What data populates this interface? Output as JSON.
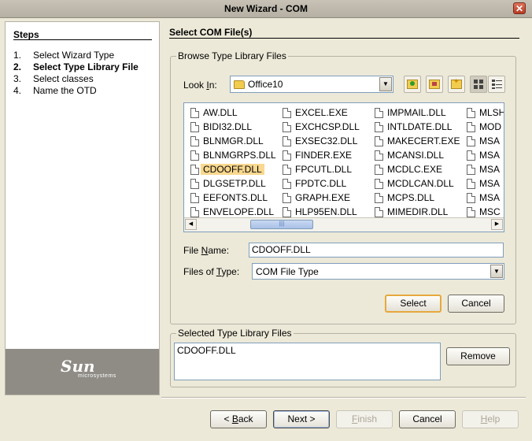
{
  "window": {
    "title": "New Wizard - COM",
    "close_glyph": "✕"
  },
  "steps": {
    "title": "Steps",
    "items": [
      {
        "num": "1.",
        "label": "Select Wizard Type"
      },
      {
        "num": "2.",
        "label": "Select Type Library File"
      },
      {
        "num": "3.",
        "label": "Select classes"
      },
      {
        "num": "4.",
        "label": "Name the OTD"
      }
    ],
    "current_index": 1
  },
  "branding": {
    "logo_text": "Sun",
    "logo_subtext": "microsystems"
  },
  "main": {
    "section_title": "Select COM File(s)",
    "browse": {
      "group_label": "Browse Type Library Files",
      "look_in_label_pre": "Look ",
      "look_in_label_key": "I",
      "look_in_label_post": "n:",
      "look_in_value": "Office10",
      "toolbar_icons": [
        "up-folder-icon",
        "home-folder-icon",
        "new-folder-icon",
        "list-view-icon",
        "details-view-icon"
      ],
      "files": {
        "col1": [
          "AW.DLL",
          "BIDI32.DLL",
          "BLNMGR.DLL",
          "BLNMGRPS.DLL",
          "CDOOFF.DLL",
          "DLGSETP.DLL",
          "EEFONTS.DLL",
          "ENVELOPE.DLL"
        ],
        "col2": [
          "EXCEL.EXE",
          "EXCHCSP.DLL",
          "EXSEC32.DLL",
          "FINDER.EXE",
          "FPCUTL.DLL",
          "FPDTC.DLL",
          "GRAPH.EXE",
          "HLP95EN.DLL"
        ],
        "col3": [
          "IMPMAIL.DLL",
          "INTLDATE.DLL",
          "MAKECERT.EXE",
          "MCANSI.DLL",
          "MCDLC.EXE",
          "MCDLCAN.DLL",
          "MCPS.DLL",
          "MIMEDIR.DLL"
        ],
        "col4": [
          "MLSH",
          "MOD",
          "MSA",
          "MSA",
          "MSA",
          "MSA",
          "MSA",
          "MSC"
        ]
      },
      "selected_file": "CDOOFF.DLL",
      "file_name_label_pre": "File ",
      "file_name_label_key": "N",
      "file_name_label_post": "ame:",
      "file_name_value": "CDOOFF.DLL",
      "files_of_type_label_pre": "Files of ",
      "files_of_type_label_key": "T",
      "files_of_type_label_post": "ype:",
      "files_of_type_value": "COM File Type",
      "select_label": "Select",
      "cancel_label": "Cancel"
    },
    "selected": {
      "group_label": "Selected Type Library Files",
      "items": [
        "CDOOFF.DLL"
      ],
      "remove_label": "Remove"
    }
  },
  "footer": {
    "back_pre": "< ",
    "back_key": "B",
    "back_post": "ack",
    "next_label": "Next >",
    "finish_pre": "",
    "finish_key": "F",
    "finish_post": "inish",
    "cancel_label": "Cancel",
    "help_pre": "",
    "help_key": "H",
    "help_post": "elp"
  }
}
